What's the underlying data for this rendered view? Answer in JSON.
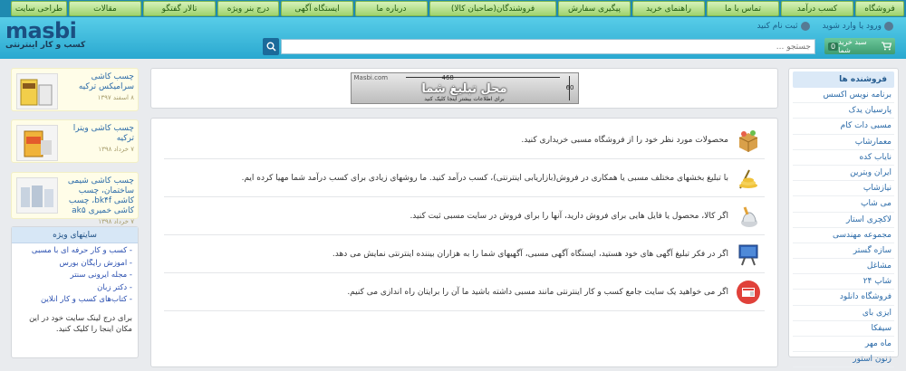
{
  "top_nav": [
    "فروشگاه",
    "کسب درآمد",
    "تماس با ما",
    "راهنمای خرید",
    "پیگیری سفارش",
    "فروشندگان(صاحبان کالا)",
    "درباره ما",
    "ایستگاه آگهی",
    "درج بنر ویژه",
    "تالار گفتگو",
    "مقالات",
    "طراحی سایت"
  ],
  "header": {
    "logo": "masbi",
    "tagline": "کسب و کار اینترنتی",
    "login": "ورود یا وارد شوید",
    "register": "ثبت نام کنید",
    "cart_label": "سبد خرید شما",
    "cart_count": "0",
    "search_placeholder": "جستجو ..."
  },
  "sidebar": {
    "title": "فروشنده ها",
    "items": [
      "برنامه نویس اکسس",
      "پارسیان یدک",
      "مسبی دات کام",
      "معمارشاپ",
      "ناياب كده",
      "ایران وبترین",
      "نیازشاپ",
      "می شاپ",
      "لاکچری استار",
      "مجموعه مهندسی",
      "سازه گستر",
      "مشاغل",
      "شاپ ۲۴",
      "فروشگاه دانلود",
      "ایزی بای",
      "سیفکا",
      "ماه مهر",
      "زنون استور"
    ]
  },
  "banner": {
    "site": "Masbi.com",
    "width": "468",
    "height": "60",
    "title": "محل تبلیغ شما",
    "note": "برای اطلاعات بیشتر اینجا کلیک کنید"
  },
  "info_rows": [
    {
      "icon": "shop-box-icon",
      "text": "محصولات مورد نظر خود را از فروشگاه مسبی خریداری کنید."
    },
    {
      "icon": "coins-icon",
      "text": "با تبلیغ بخشهای مختلف مسبی یا همکاری در فروش(بازاریابی اینترنتی)، کسب درآمد کنید. ما روشهای زیادی برای کسب درآمد شما مهیا کرده ایم."
    },
    {
      "icon": "product-upload-icon",
      "text": "اگر کالا، محصول یا فایل هایی برای فروش دارید، آنها را برای فروش در سایت مسبی ثبت کنید."
    },
    {
      "icon": "billboard-icon",
      "text": "اگر در فکر تبلیغ آگهی های خود هستید، ایستگاه آگهی مسبی، آگهیهای شما را به هزاران بیننده اینترنتی نمایش می دهد."
    },
    {
      "icon": "website-icon",
      "text": "اگر می خواهید یک سایت جامع کسب و کار اینترنتی مانند مسبی داشته باشید ما آن را برایتان راه اندازی می کنیم."
    }
  ],
  "products": [
    {
      "title": "چسب کاشی سرامیکس ترکیه",
      "date": "۸ اسفند ۱۳۹۷"
    },
    {
      "title": "چسب کاشی ویترا ترکیه",
      "date": "۷ خرداد ۱۳۹۸"
    },
    {
      "title": "چسب کاشی شیمی ساختمان، چسب کاشی bk۴f، چسب کاشی خمیری ak۵",
      "date": "۷ خرداد ۱۳۹۸"
    }
  ],
  "special_sites": {
    "title": "سایتهای ویژه",
    "items": [
      "- کسب و کار حرفه ای با مسبی",
      "- آموزش رایگان بورس",
      "- مجله ایرونی سنتر",
      "- دکتر زبان",
      "- کتاب‌های کسب و کار آنلاین"
    ],
    "note": "برای درج لینک سایت خود در این مکان اینجا را کلیک کنید."
  },
  "colors": {
    "nav_tab": "#a9d97b",
    "header": "#3ab9dd",
    "link": "#2a6aa8"
  }
}
